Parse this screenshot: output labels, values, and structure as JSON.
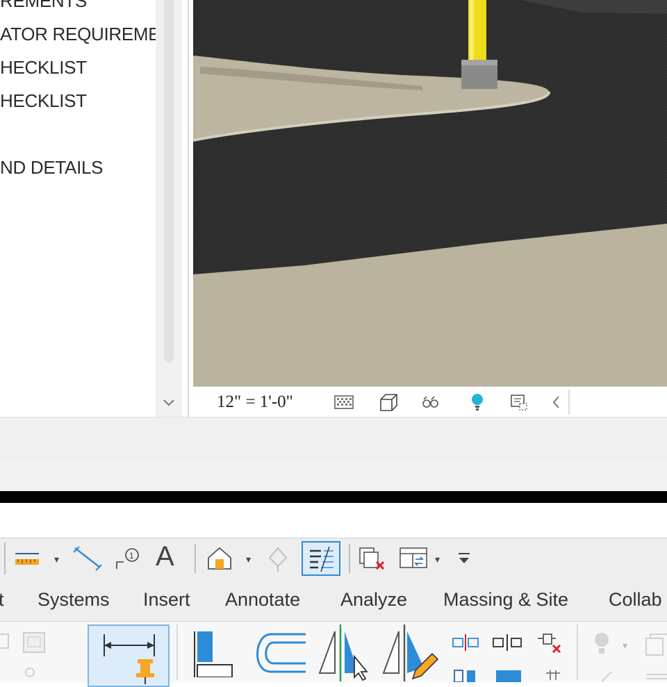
{
  "browser": {
    "items": [
      "REMENTS",
      "ATOR REQUIREME",
      "HECKLIST",
      "HECKLIST",
      "ND DETAILS"
    ]
  },
  "view_control": {
    "scale": "12\" = 1'-0\""
  },
  "quick_access": {
    "text_tool_label": "A"
  },
  "ribbon": {
    "tabs": [
      "t",
      "Systems",
      "Insert",
      "Annotate",
      "Analyze",
      "Massing & Site",
      "Collab"
    ]
  },
  "colors": {
    "accent_blue": "#2e8bd6",
    "highlight_bg": "#dcecfb",
    "pin_orange": "#f5a623",
    "delete_red": "#e02020",
    "road_asphalt": "#2f2f2f",
    "sidewalk_tan": "#b8b29c",
    "post_yellow": "#f0e020"
  },
  "icons": [
    "down-chevron-icon",
    "detail-level-icon",
    "visual-style-icon",
    "sun-path-icon",
    "light-bulb-icon",
    "crop-region-icon",
    "left-chevron-icon",
    "measure-icon",
    "aligned-dimension-icon",
    "tag-icon",
    "text-icon",
    "default-3d-view-icon",
    "section-icon",
    "thin-lines-icon",
    "close-hidden-icon",
    "switch-windows-icon",
    "customize-qat-icon",
    "pin-icon",
    "align-icon",
    "offset-icon",
    "mirror-pick-axis-icon",
    "mirror-draw-axis-icon",
    "split-icon",
    "split-with-gap-icon",
    "unpin-icon",
    "light-icon"
  ]
}
